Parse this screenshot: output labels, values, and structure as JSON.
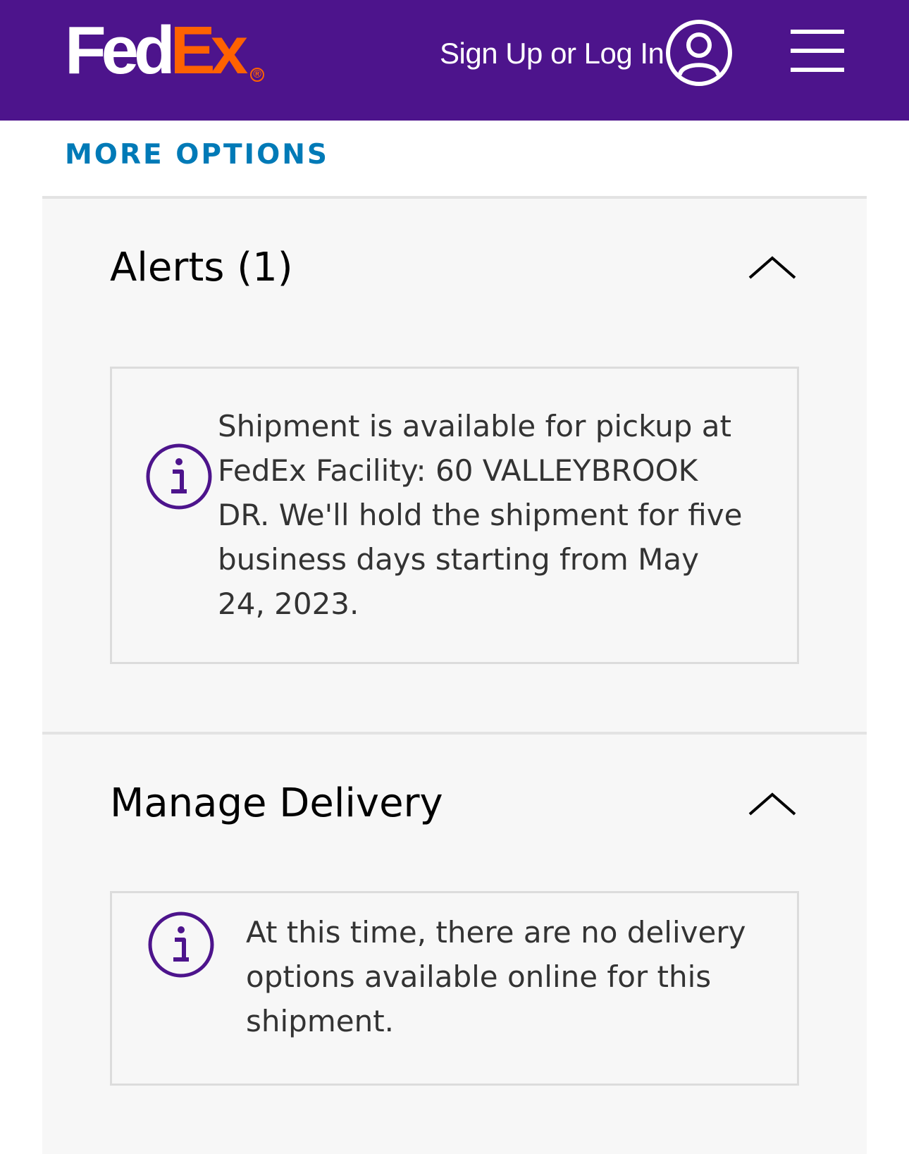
{
  "header": {
    "logo_fed": "Fed",
    "logo_ex": "Ex",
    "logo_reg": "®",
    "signin_label": "Sign Up or Log In",
    "background_color": "#4d148c",
    "user_icon": "user-circle-icon",
    "menu_icon": "hamburger-menu-icon"
  },
  "more_options": {
    "label": "MORE OPTIONS",
    "color": "#007ab7"
  },
  "alerts": {
    "title": "Alerts (1)",
    "expanded": true,
    "toggle_icon": "chevron-up-icon",
    "items": [
      {
        "icon": "info-icon",
        "text": "Shipment is available for pickup at FedEx Facility: 60 VALLEYBROOK DR. We'll hold the shipment for five business days starting from May 24, 2023."
      }
    ]
  },
  "manage_delivery": {
    "title": "Manage Delivery",
    "expanded": true,
    "toggle_icon": "chevron-up-icon",
    "message": {
      "icon": "info-icon",
      "text": "At this time, there are no delivery options available online for this shipment."
    }
  },
  "colors": {
    "brand_purple": "#4d148c",
    "brand_orange": "#ff6200",
    "info_icon": "#4d148c",
    "panel_bg": "#f7f7f7"
  }
}
